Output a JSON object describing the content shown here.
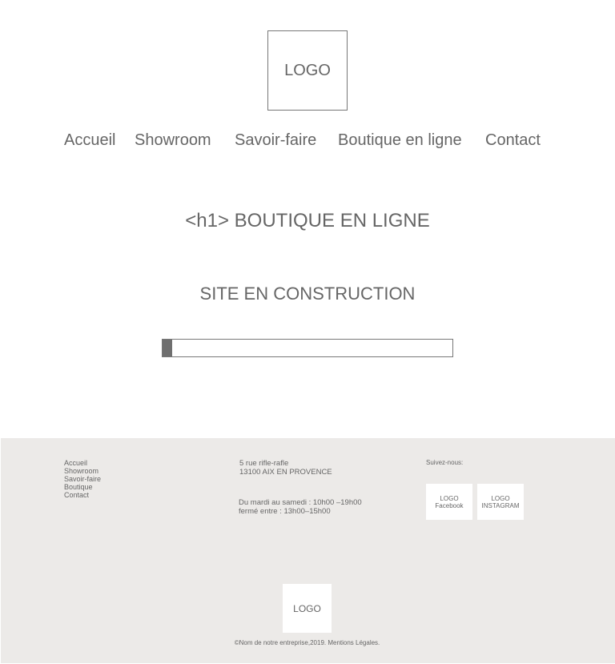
{
  "header": {
    "logo": "LOGO"
  },
  "nav": [
    {
      "label": "Accueil"
    },
    {
      "label": "Showroom"
    },
    {
      "label": "Savoir-faire"
    },
    {
      "label": "Boutique en ligne"
    },
    {
      "label": "Contact"
    }
  ],
  "main": {
    "title": "<h1> BOUTIQUE EN LIGNE",
    "subtitle": "SITE EN CONSTRUCTION",
    "progress": 0.033
  },
  "footer": {
    "links": [
      "Accueil",
      "Showroom",
      "Savoir-faire",
      "Boutique",
      "Contact"
    ],
    "address_line1": "5 rue rifle-rafle",
    "address_line2": "13100 AIX EN PROVENCE",
    "hours_line1": "Du mardi au samedi : 10h00 –19h00",
    "hours_line2": "fermé entre  : 13h00–15h00",
    "follow": "Suivez-nous:",
    "facebook_line1": "LOGO",
    "facebook_line2": "Facebook",
    "instagram_line1": "LOGO",
    "instagram_line2": "INSTAGRAM",
    "logo": "LOGO",
    "copyright": "©Nom de notre entreprise,2019. Mentions  Légales."
  },
  "colors": {
    "text": "#666666",
    "footer_bg": "#eceae8",
    "progress_fill": "#6f6f6f",
    "border": "#777777"
  }
}
